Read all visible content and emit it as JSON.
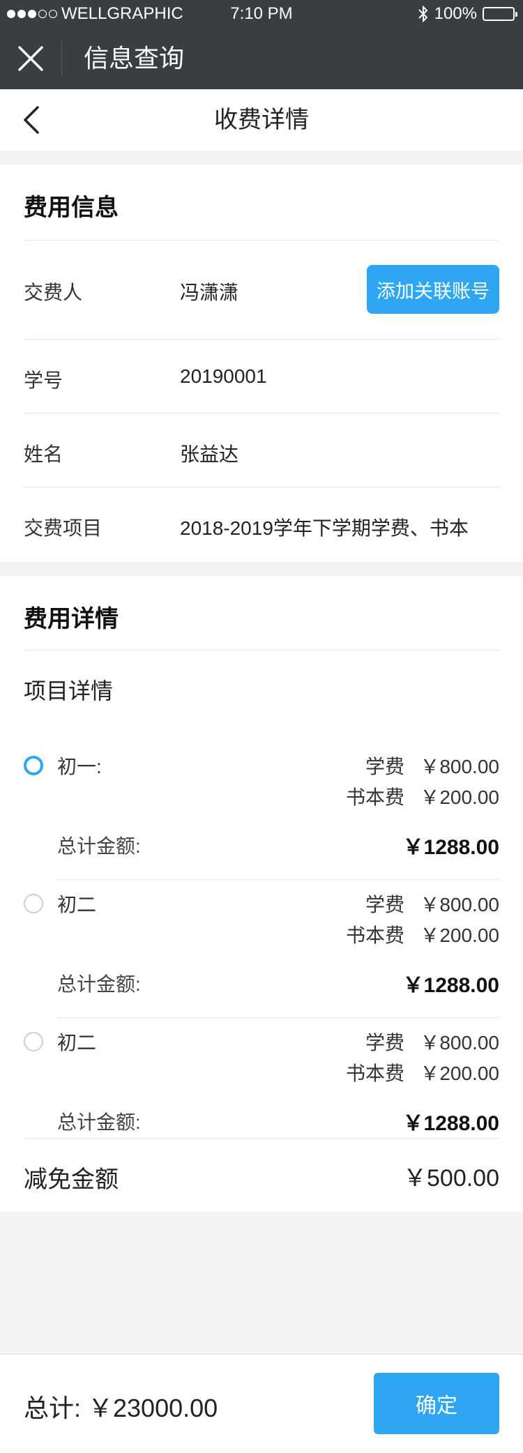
{
  "status_bar": {
    "carrier": "WELLGRAPHIC",
    "time": "7:10 PM",
    "battery": "100%"
  },
  "wx_header": {
    "title": "信息查询"
  },
  "page_header": {
    "title": "收费详情"
  },
  "fee_info": {
    "title": "费用信息",
    "payer_label": "交费人",
    "payer_value": "冯潇潇",
    "add_button": "添加关联账号",
    "rows": [
      {
        "label": "学号",
        "value": "20190001"
      },
      {
        "label": "姓名",
        "value": "张益达"
      },
      {
        "label": "交费项目",
        "value": "2018-2019学年下学期学费、书本"
      }
    ]
  },
  "fee_detail": {
    "title": "费用详情",
    "subtitle": "项目详情",
    "items": [
      {
        "name": "初一:",
        "checked": true,
        "fees": [
          {
            "label": "学费",
            "amount": "￥800.00"
          },
          {
            "label": "书本费",
            "amount": "￥200.00"
          }
        ],
        "total_label": "总计金额:",
        "total": "￥1288.00"
      },
      {
        "name": "初二",
        "checked": false,
        "fees": [
          {
            "label": "学费",
            "amount": "￥800.00"
          },
          {
            "label": "书本费",
            "amount": "￥200.00"
          }
        ],
        "total_label": "总计金额:",
        "total": "￥1288.00"
      },
      {
        "name": "初二",
        "checked": false,
        "fees": [
          {
            "label": "学费",
            "amount": "￥800.00"
          },
          {
            "label": "书本费",
            "amount": "￥200.00"
          }
        ],
        "total_label": "总计金额:",
        "total": "￥1288.00"
      }
    ],
    "discount_label": "减免金额",
    "discount_value": "￥500.00"
  },
  "bottom": {
    "total": "总计: ￥23000.00",
    "confirm": "确定"
  },
  "colors": {
    "accent": "#2ea6f2",
    "header_bg": "#3a3d41",
    "page_bg": "#f3f3f3"
  },
  "icons": [
    "signal-dots-icon",
    "bluetooth-icon",
    "battery-icon",
    "close-icon",
    "back-arrow-icon",
    "radio-icon"
  ]
}
